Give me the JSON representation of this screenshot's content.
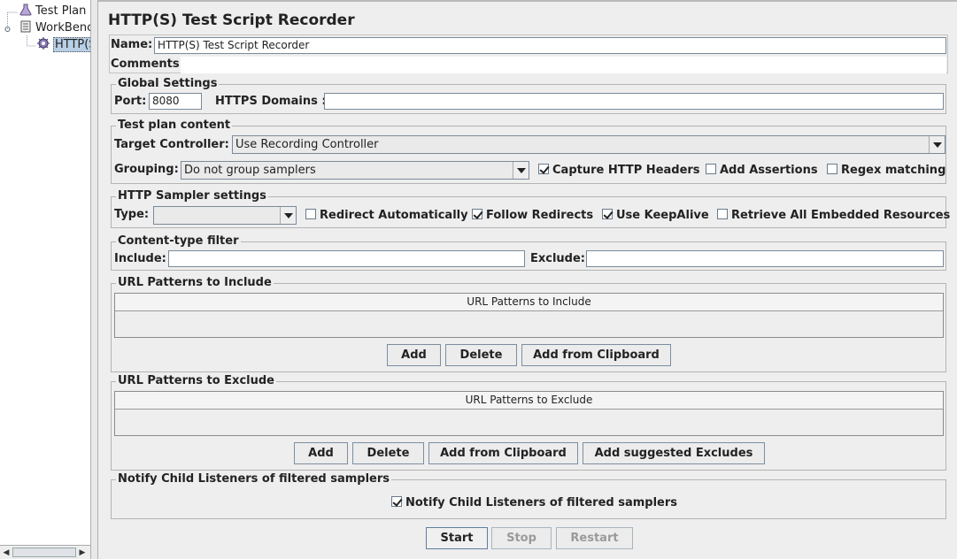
{
  "tree": {
    "items": [
      {
        "label": "Test Plan"
      },
      {
        "label": "WorkBench"
      },
      {
        "label": "HTTP(S) Test Script Recorder"
      }
    ]
  },
  "title": "HTTP(S) Test Script Recorder",
  "name_label": "Name:",
  "name_value": "HTTP(S) Test Script Recorder",
  "comments_label": "Comments:",
  "comments_value": "",
  "global": {
    "legend": "Global Settings",
    "port_label": "Port:",
    "port_value": "8080",
    "domains_label": "HTTPS Domains :",
    "domains_value": ""
  },
  "plan": {
    "legend": "Test plan content",
    "target_label": "Target Controller:",
    "target_value": "Use Recording Controller",
    "grouping_label": "Grouping:",
    "grouping_value": "Do not group samplers",
    "capture_headers": "Capture HTTP Headers",
    "add_assertions": "Add Assertions",
    "regex_matching": "Regex matching"
  },
  "sampler": {
    "legend": "HTTP Sampler settings",
    "type_label": "Type:",
    "type_value": "",
    "redirect_auto": "Redirect Automatically",
    "follow_redirects": "Follow Redirects",
    "keepalive": "Use KeepAlive",
    "retrieve_embedded": "Retrieve All Embedded Resources"
  },
  "content_filter": {
    "legend": "Content-type filter",
    "include_label": "Include:",
    "include_value": "",
    "exclude_label": "Exclude:",
    "exclude_value": ""
  },
  "include_patterns": {
    "legend": "URL Patterns to Include",
    "column": "URL Patterns to Include",
    "add": "Add",
    "delete": "Delete",
    "clipboard": "Add from Clipboard"
  },
  "exclude_patterns": {
    "legend": "URL Patterns to Exclude",
    "column": "URL Patterns to Exclude",
    "add": "Add",
    "delete": "Delete",
    "clipboard": "Add from Clipboard",
    "suggested": "Add suggested Excludes"
  },
  "notify": {
    "legend": "Notify Child Listeners of filtered samplers",
    "checkbox": "Notify Child Listeners of filtered samplers"
  },
  "controls": {
    "start": "Start",
    "stop": "Stop",
    "restart": "Restart"
  },
  "icons": {
    "test_plan": "flask-icon",
    "workbench": "clipboard-icon",
    "recorder": "gear-icon"
  }
}
